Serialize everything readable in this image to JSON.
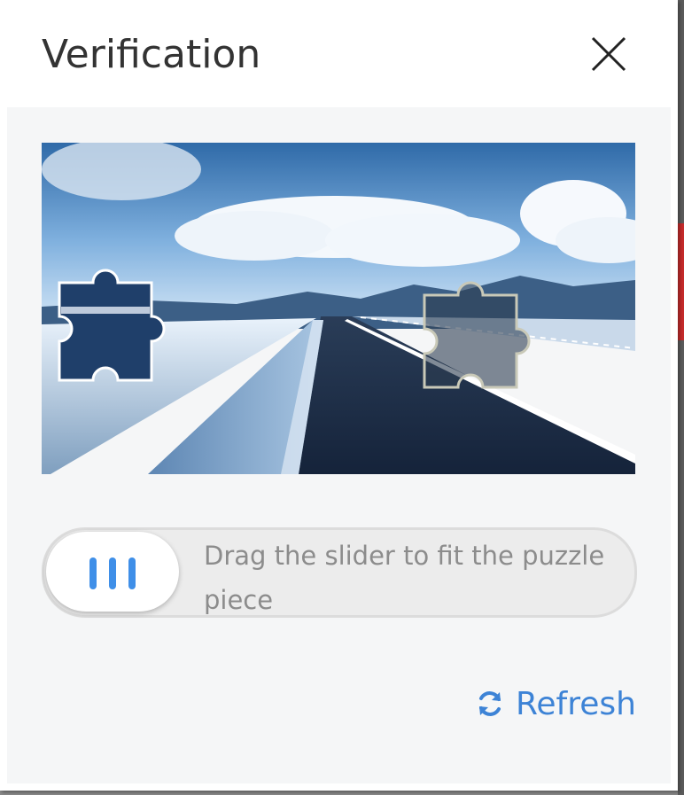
{
  "dialog": {
    "title": "Verification",
    "close_icon": "close-icon"
  },
  "captcha": {
    "image_description_icon": "puzzle-piece-icon",
    "slider_hint": "Drag the slider to fit the puzzle piece",
    "handle_icon": "grip-icon",
    "slider_progress": 0,
    "refresh_label": "Refresh",
    "refresh_icon": "refresh-icon"
  },
  "colors": {
    "accent": "#3d83d6",
    "grip": "#3f8fe8",
    "panel_bg": "#f5f6f7"
  }
}
